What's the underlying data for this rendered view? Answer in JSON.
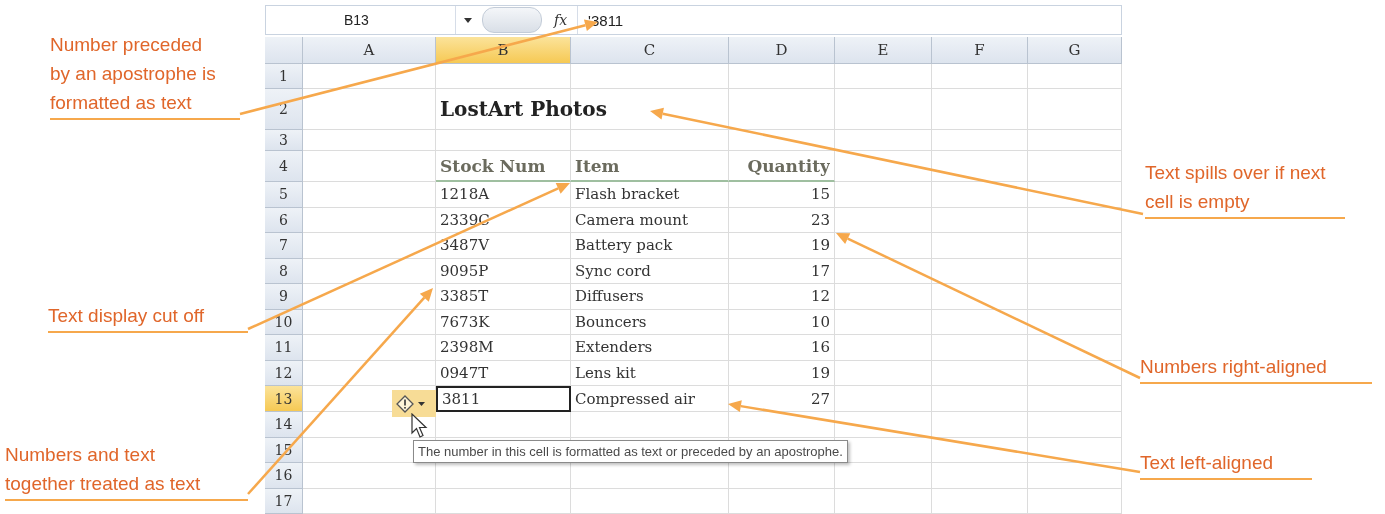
{
  "formula_bar": {
    "name_box": "B13",
    "function_label": "fx",
    "value": "'3811"
  },
  "columns": [
    {
      "label": "A",
      "selected": false
    },
    {
      "label": "B",
      "selected": true
    },
    {
      "label": "C",
      "selected": false
    },
    {
      "label": "D",
      "selected": false
    },
    {
      "label": "E",
      "selected": false
    },
    {
      "label": "F",
      "selected": false
    },
    {
      "label": "G",
      "selected": false
    }
  ],
  "rows": [
    {
      "number": "1",
      "kind": "empty",
      "selected": false
    },
    {
      "number": "2",
      "kind": "title",
      "selected": false,
      "title": "LostArt Photos"
    },
    {
      "number": "3",
      "kind": "empty",
      "selected": false
    },
    {
      "number": "4",
      "kind": "header",
      "selected": false,
      "stock_number": "Stock Num",
      "item": "Item",
      "quantity": "Quantity"
    },
    {
      "number": "5",
      "kind": "data",
      "selected": false,
      "stock_number": "1218A",
      "item": "Flash bracket",
      "quantity": "15"
    },
    {
      "number": "6",
      "kind": "data",
      "selected": false,
      "stock_number": "2339C",
      "item": "Camera mount",
      "quantity": "23"
    },
    {
      "number": "7",
      "kind": "data",
      "selected": false,
      "stock_number": "3487V",
      "item": "Battery pack",
      "quantity": "19"
    },
    {
      "number": "8",
      "kind": "data",
      "selected": false,
      "stock_number": "9095P",
      "item": "Sync cord",
      "quantity": "17"
    },
    {
      "number": "9",
      "kind": "data",
      "selected": false,
      "stock_number": "3385T",
      "item": "Diffusers",
      "quantity": "12"
    },
    {
      "number": "10",
      "kind": "data",
      "selected": false,
      "stock_number": "7673K",
      "item": "Bouncers",
      "quantity": "10"
    },
    {
      "number": "11",
      "kind": "data",
      "selected": false,
      "stock_number": "2398M",
      "item": "Extenders",
      "quantity": "16"
    },
    {
      "number": "12",
      "kind": "data",
      "selected": false,
      "stock_number": "0947T",
      "item": "Lens kit",
      "quantity": "19"
    },
    {
      "number": "13",
      "kind": "data",
      "selected": true,
      "stock_number": "3811",
      "item": "Compressed air",
      "quantity": "27"
    },
    {
      "number": "14",
      "kind": "empty",
      "selected": false
    },
    {
      "number": "15",
      "kind": "empty",
      "selected": false
    },
    {
      "number": "16",
      "kind": "empty",
      "selected": false
    },
    {
      "number": "17",
      "kind": "empty",
      "selected": false
    }
  ],
  "error_tooltip": "The number in this cell is formatted as text or preceded by an apostrophe.",
  "left_callouts": [
    {
      "text": "Number preceded\nby an apostrophe is\nformatted as text"
    },
    {
      "text": "Text display cut off"
    },
    {
      "text": "Numbers and text\ntogether treated as text"
    }
  ],
  "right_callouts": [
    {
      "text": "Text spills over if next\ncell is empty"
    },
    {
      "text": "Numbers right-aligned"
    },
    {
      "text": "Text left-aligned"
    }
  ]
}
